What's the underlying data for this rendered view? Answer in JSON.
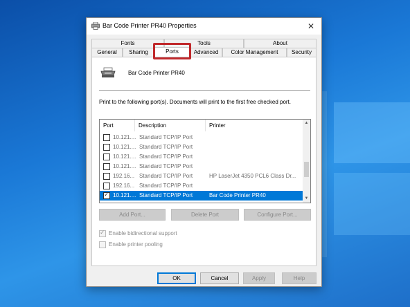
{
  "window": {
    "title": "Bar Code Printer PR40 Properties",
    "close_glyph": "✕"
  },
  "tabs": {
    "back_row": [
      {
        "label": "Fonts"
      },
      {
        "label": "Tools"
      },
      {
        "label": "About"
      }
    ],
    "front_row": [
      {
        "label": "General"
      },
      {
        "label": "Sharing"
      },
      {
        "label": "Ports",
        "active": true
      },
      {
        "label": "Advanced"
      },
      {
        "label": "Color Management"
      },
      {
        "label": "Security"
      }
    ]
  },
  "ports_page": {
    "printer_name": "Bar Code Printer PR40",
    "description": "Print to the following port(s). Documents will print to the first free checked port.",
    "columns": {
      "port": "Port",
      "description": "Description",
      "printer": "Printer"
    },
    "rows": [
      {
        "port": "10.121....",
        "description": "Standard TCP/IP Port",
        "printer": "",
        "checked": false,
        "selected": false
      },
      {
        "port": "10.121....",
        "description": "Standard TCP/IP Port",
        "printer": "",
        "checked": false,
        "selected": false
      },
      {
        "port": "10.121....",
        "description": "Standard TCP/IP Port",
        "printer": "",
        "checked": false,
        "selected": false
      },
      {
        "port": "10.121....",
        "description": "Standard TCP/IP Port",
        "printer": "",
        "checked": false,
        "selected": false
      },
      {
        "port": "192.16...",
        "description": "Standard TCP/IP Port",
        "printer": "HP LaserJet 4350 PCL6 Class Dr...",
        "checked": false,
        "selected": false
      },
      {
        "port": "192.16...",
        "description": "Standard TCP/IP Port",
        "printer": "",
        "checked": false,
        "selected": false
      },
      {
        "port": "10.121....",
        "description": "Standard TCP/IP Port",
        "printer": "Bar Code Printer PR40",
        "checked": true,
        "selected": true
      }
    ],
    "buttons": {
      "add_port": "Add Port...",
      "delete_port": "Delete Port",
      "configure_port": "Configure Port..."
    },
    "bidirectional_label": "Enable bidirectional support",
    "bidirectional_checked": true,
    "pooling_label": "Enable printer pooling",
    "pooling_checked": false
  },
  "footer": {
    "ok": "OK",
    "cancel": "Cancel",
    "apply": "Apply",
    "help": "Help"
  },
  "colors": {
    "accent": "#0078d7",
    "highlight_box": "#c0282b",
    "desktop": "#1a78d6"
  },
  "icons": {
    "window": "printer-icon",
    "close": "close-icon",
    "scroll_up": "chevron-up-icon",
    "scroll_down": "chevron-down-icon"
  }
}
